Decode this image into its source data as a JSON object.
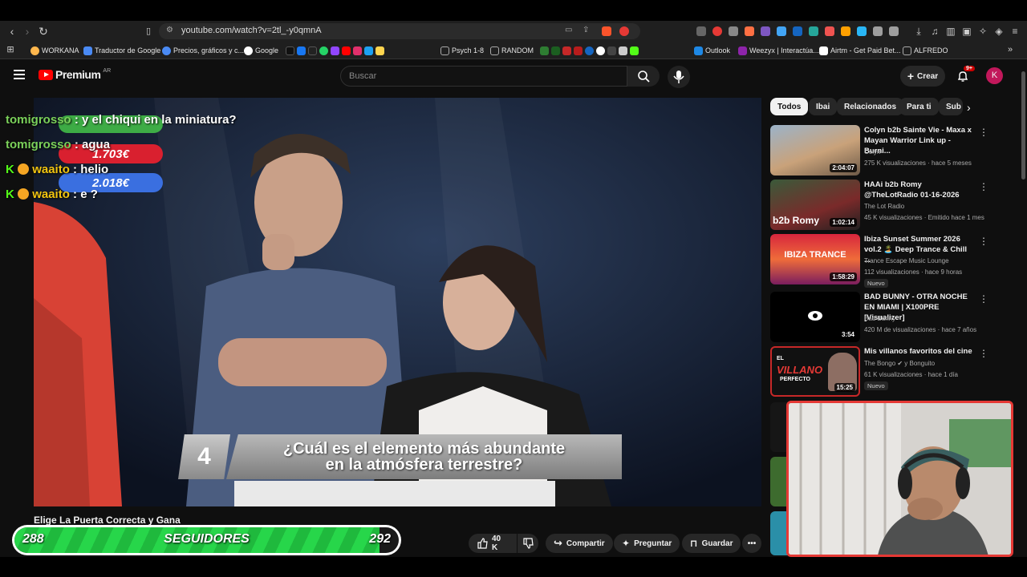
{
  "browser": {
    "url": "youtube.com/watch?v=2tl_-y0qmnA",
    "bookmarks": [
      {
        "label": "WORKANA",
        "color": "#ffb74d"
      },
      {
        "label": "Traductor de Google",
        "color": "#4a8af4"
      },
      {
        "label": "Precios, gráficos y c...",
        "color": "#4a8af4"
      },
      {
        "label": "Google",
        "color": "#ffffff"
      },
      {
        "label": "Psych 1-8",
        "color": "#888888"
      },
      {
        "label": "RANDOM",
        "color": "#888888"
      },
      {
        "label": "Outlook",
        "color": "#1e88e5"
      },
      {
        "label": "Weezyx | Interactúa...",
        "color": "#8e24aa"
      },
      {
        "label": "Airtm - Get Paid Bet...",
        "color": "#ffffff"
      },
      {
        "label": "ALFREDO",
        "color": "#888888"
      }
    ]
  },
  "youtube": {
    "logo_text": "Premium",
    "logo_region": "AR",
    "search_placeholder": "Buscar",
    "create_label": "Crear",
    "notifications_badge": "9+",
    "avatar_letter": "K"
  },
  "video": {
    "title": "Elige La Puerta Correcta y Gana",
    "question_number": "4",
    "question_text_1": "¿Cuál es el elemento más abundante",
    "question_text_2": "en la atmósfera terrestre?",
    "actions": {
      "likes": "40 K",
      "share": "Compartir",
      "ask": "Preguntar",
      "save": "Guardar"
    }
  },
  "chat": [
    {
      "name": "tomigrosso",
      "sep": " : ",
      "text": "y el chiqui en la miniatura?"
    },
    {
      "name": "tomigrosso",
      "sep": " : ",
      "text": "agua"
    },
    {
      "name": "waaito",
      "sep": " : ",
      "text": "helio"
    },
    {
      "name": "waaito",
      "sep": " : ",
      "text": "e ?"
    }
  ],
  "donations": [
    {
      "amount": "1.703€",
      "color": "#d9202f"
    },
    {
      "amount": "2.018€",
      "color": "#3a6fe0"
    }
  ],
  "followers_bar": {
    "left": "288",
    "label": "SEGUIDORES",
    "right": "292",
    "progress": 0.95
  },
  "chips": [
    "Todos",
    "Ibai",
    "Relacionados",
    "Para ti",
    "Sub"
  ],
  "recommendations": [
    {
      "title": "Colyn b2b Sainte Vie - Maxa x Mayan Warrior Link up - Burni...",
      "channel": "Colyn",
      "meta": "275 K visualizaciones · hace 5 meses",
      "duration": "2:04:07",
      "new": ""
    },
    {
      "title": "HAAi b2b Romy @TheLotRadio 01-16-2026",
      "channel": "The Lot Radio",
      "meta": "45 K visualizaciones · Emitido hace 1 mes",
      "duration": "1:02:14",
      "new": ""
    },
    {
      "title": "Ibiza Sunset Summer 2026 vol.2 🏝️ Deep Trance & Chill ...",
      "channel": "Trance Escape Music Lounge",
      "meta": "112 visualizaciones · hace 9 horas",
      "duration": "1:58:29",
      "new": "Nuevo"
    },
    {
      "title": "BAD BUNNY - OTRA NOCHE EN MIAMI | X100PRE [Visualizer]",
      "channel": "Bad Bunny",
      "meta": "420 M de visualizaciones · hace 7 años",
      "duration": "3:54",
      "new": ""
    },
    {
      "title": "Mis villanos favoritos del cine",
      "channel": "The Bongo ✔ y Bonguito",
      "meta": "61 K visualizaciones · hace 1 día",
      "duration": "15:25",
      "new": "Nuevo"
    }
  ],
  "thumb_texts": {
    "t2": "b2b Romy",
    "t3": "IBIZA TRANCE",
    "t5a": "EL",
    "t5b": "VILLANO",
    "t5c": "PERFECTO"
  }
}
